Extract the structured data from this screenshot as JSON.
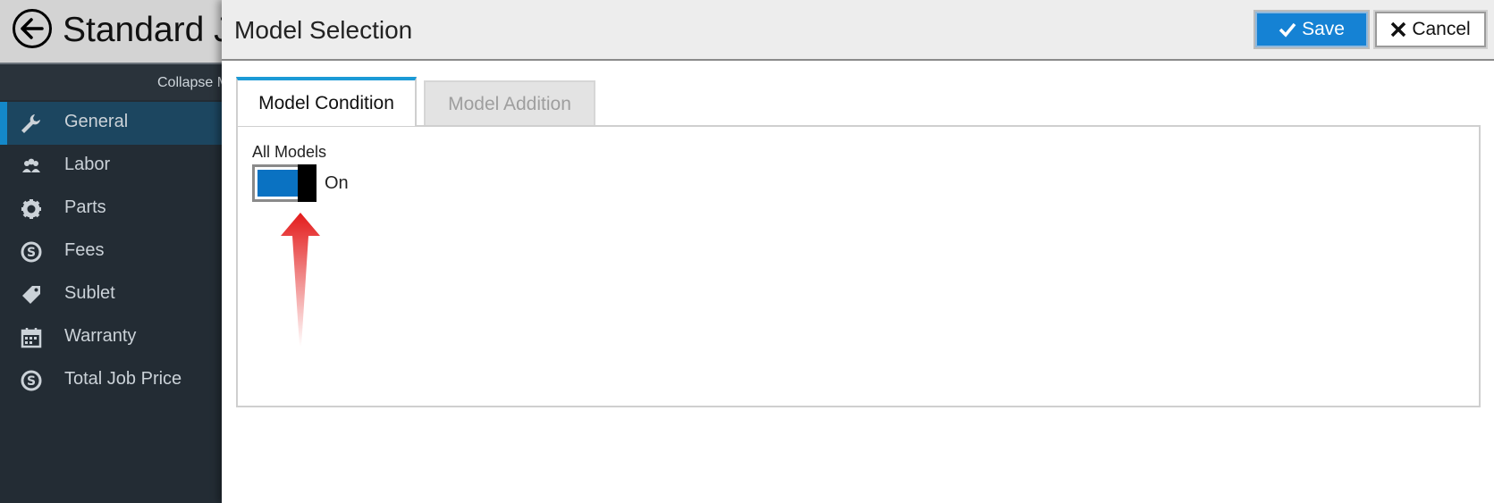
{
  "app": {
    "title": "Standard J",
    "collapse_label": "Collapse M",
    "nav": [
      {
        "label": "General",
        "icon": "wrench-icon",
        "active": true
      },
      {
        "label": "Labor",
        "icon": "people-icon",
        "active": false
      },
      {
        "label": "Parts",
        "icon": "gear-icon",
        "active": false
      },
      {
        "label": "Fees",
        "icon": "dollar-circle-icon",
        "active": false
      },
      {
        "label": "Sublet",
        "icon": "tag-icon",
        "active": false
      },
      {
        "label": "Warranty",
        "icon": "calendar-icon",
        "active": false
      },
      {
        "label": "Total Job Price",
        "icon": "dollar-circle-icon",
        "active": false
      }
    ]
  },
  "dialog": {
    "title": "Model Selection",
    "save_label": "Save",
    "cancel_label": "Cancel",
    "tabs": [
      {
        "label": "Model Condition",
        "active": true
      },
      {
        "label": "Model Addition",
        "active": false
      }
    ],
    "all_models": {
      "label": "All Models",
      "state_text": "On",
      "checked": true
    }
  },
  "colors": {
    "accent": "#1582d4",
    "sidebar_bg": "#232c34",
    "active_nav": "#1c4660",
    "annotation_arrow": "#e31b1b"
  }
}
